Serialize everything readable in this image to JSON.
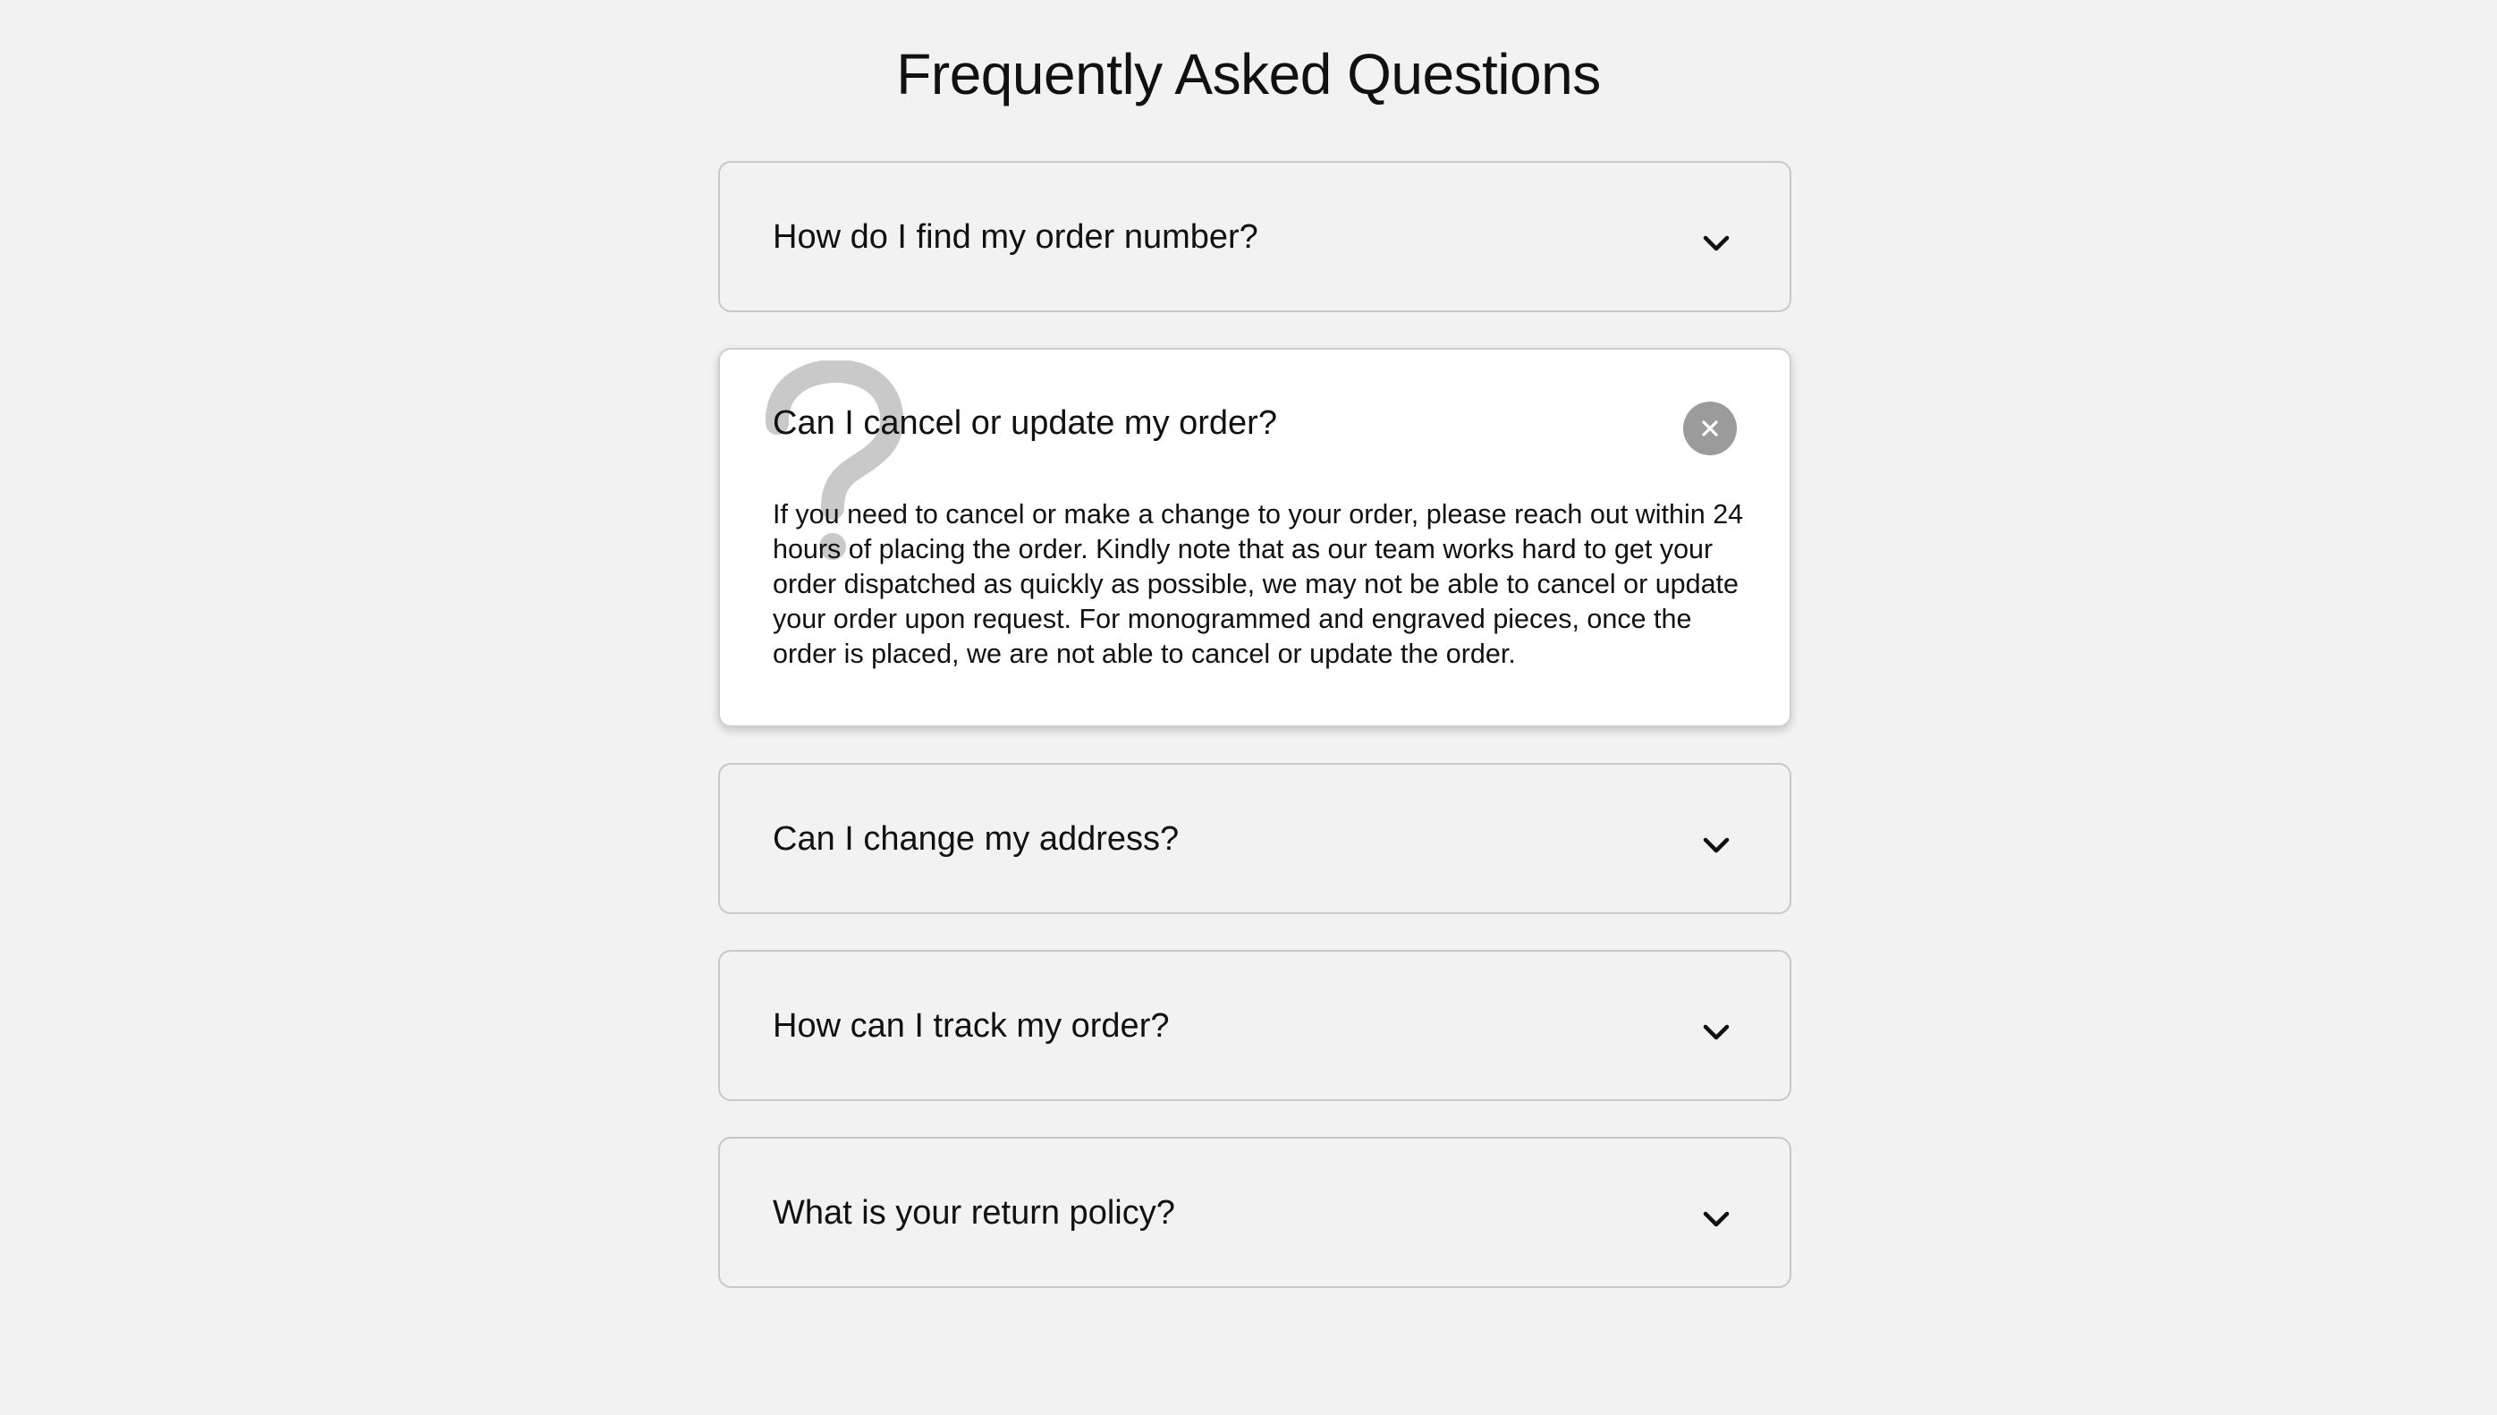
{
  "page": {
    "title": "Frequently Asked Questions"
  },
  "faq": {
    "items": [
      {
        "question": "How do I find my order number?",
        "state": "collapsed",
        "icon": "chevron-down-icon"
      },
      {
        "question": "Can I cancel or update my order?",
        "state": "expanded",
        "icon": "close-icon",
        "decoration": "question-mark-icon",
        "answer": "If you need to cancel or make a change to your order, please reach out within 24 hours of placing the order. Kindly note that as our team works hard to get your order dispatched as quickly as possible, we may not be able to cancel or update your order upon request. For monogrammed and engraved pieces, once the order is placed, we are not able to cancel or update the order."
      },
      {
        "question": "Can I change my address?",
        "state": "collapsed",
        "icon": "chevron-down-icon"
      },
      {
        "question": "How can I track my order?",
        "state": "collapsed",
        "icon": "chevron-down-icon"
      },
      {
        "question": "What is your return policy?",
        "state": "collapsed",
        "icon": "chevron-down-icon"
      }
    ]
  },
  "colors": {
    "background": "#f2f2f2",
    "card_border": "#c8c8c8",
    "expanded_card_background": "#ffffff",
    "close_button": "#9b9b9b",
    "question_mark_watermark": "#c9c9c9",
    "text": "#111111"
  }
}
